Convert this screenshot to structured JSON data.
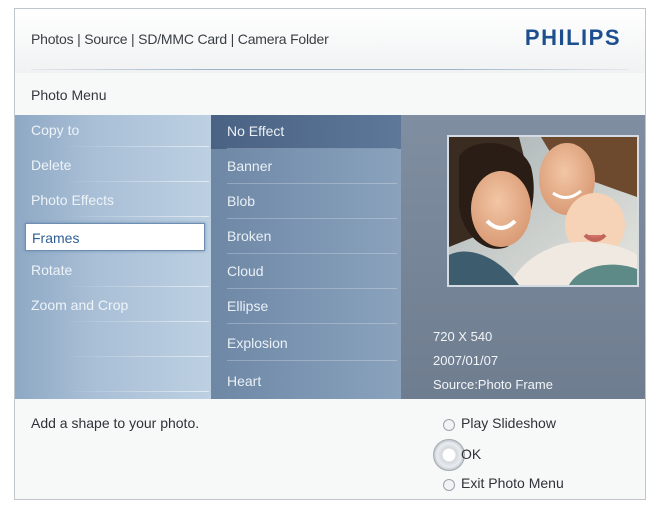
{
  "header": {
    "breadcrumb": "Photos | Source | SD/MMC Card | Camera Folder",
    "brand": "PHILIPS"
  },
  "menu_title": "Photo Menu",
  "photo_menu": [
    {
      "label": "Copy to"
    },
    {
      "label": "Delete"
    },
    {
      "label": "Photo Effects"
    },
    {
      "label": "Frames",
      "selected": true
    },
    {
      "label": "Rotate"
    },
    {
      "label": "Zoom and Crop"
    }
  ],
  "frames_list": [
    {
      "label": "No Effect",
      "highlighted": true
    },
    {
      "label": "Banner"
    },
    {
      "label": "Blob"
    },
    {
      "label": "Broken"
    },
    {
      "label": "Cloud"
    },
    {
      "label": "Ellipse"
    },
    {
      "label": "Explosion"
    },
    {
      "label": "Heart"
    }
  ],
  "preview": {
    "resolution": "720 X 540",
    "date": "2007/01/07",
    "source": "Source:Photo Frame"
  },
  "hint": "Add a shape to your photo.",
  "controls": {
    "play": "Play Slideshow",
    "ok": "OK",
    "exit": "Exit Photo Menu"
  },
  "colors": {
    "brand": "#1d4f8f",
    "selection_text": "#2f5f95"
  }
}
